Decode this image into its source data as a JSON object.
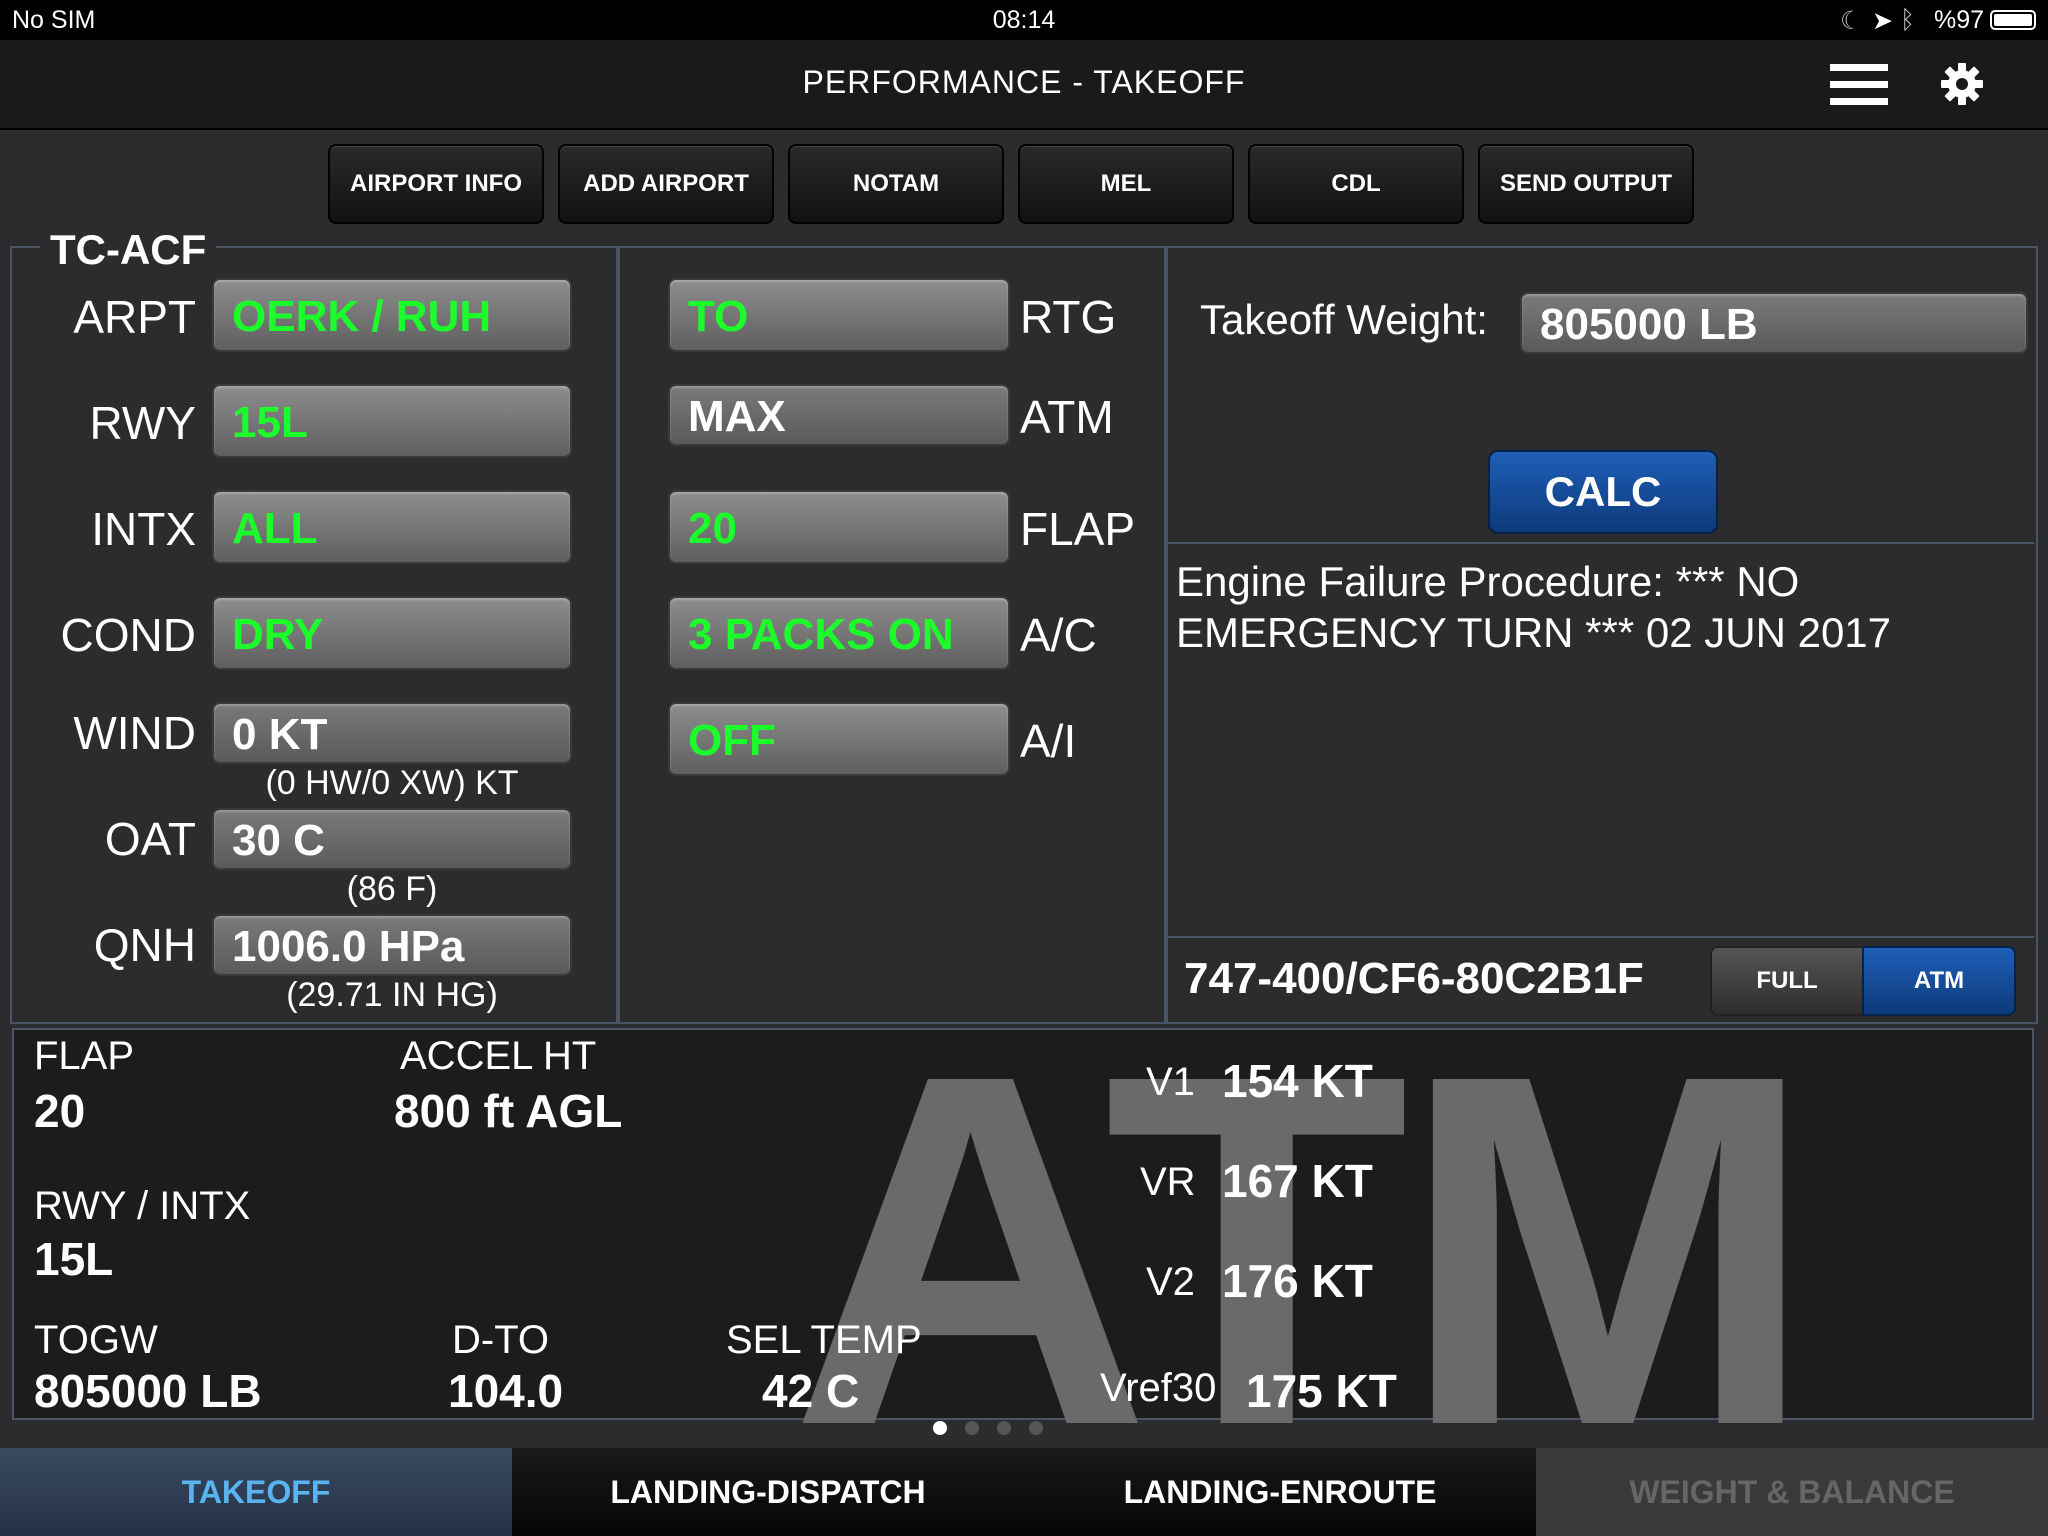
{
  "status": {
    "carrier": "No SIM",
    "time": "08:14",
    "battery": "%97"
  },
  "nav": {
    "title": "PERFORMANCE - TAKEOFF"
  },
  "topbuttons": [
    "AIRPORT INFO",
    "ADD AIRPORT",
    "NOTAM",
    "MEL",
    "CDL",
    "SEND OUTPUT"
  ],
  "tail": "TC-ACF",
  "left": {
    "arpt_label": "ARPT",
    "arpt": "OERK / RUH",
    "rwy_label": "RWY",
    "rwy": "15L",
    "intx_label": "INTX",
    "intx": "ALL",
    "cond_label": "COND",
    "cond": "DRY",
    "wind_label": "WIND",
    "wind": "0 KT",
    "wind_sub": "(0 HW/0 XW) KT",
    "oat_label": "OAT",
    "oat": "30 C",
    "oat_sub": "(86 F)",
    "qnh_label": "QNH",
    "qnh": "1006.0 HPa",
    "qnh_sub": "(29.71 IN HG)"
  },
  "middle": {
    "rtg": "TO",
    "rtg_label": "RTG",
    "atm": "MAX",
    "atm_label": "ATM",
    "flap": "20",
    "flap_label": "FLAP",
    "ac": "3 PACKS ON",
    "ac_label": "A/C",
    "ai": "OFF",
    "ai_label": "A/I"
  },
  "right": {
    "tow_label": "Takeoff Weight:",
    "tow": "805000 LB",
    "calc": "CALC",
    "efp_line1": "Engine Failure Procedure: *** NO",
    "efp_line2": "EMERGENCY TURN *** 02 JUN 2017",
    "aircraft": "747-400/CF6-80C2B1F",
    "seg_full": "FULL",
    "seg_atm": "ATM"
  },
  "results": {
    "flap_label": "FLAP",
    "flap": "20",
    "accel_label": "ACCEL HT",
    "accel": "800 ft AGL",
    "rwy_label": "RWY / INTX",
    "rwy": "15L",
    "togw_label": "TOGW",
    "togw": "805000 LB",
    "dto_label": "D-TO",
    "dto": "104.0",
    "sel_label": "SEL TEMP",
    "sel": "42 C",
    "v1_label": "V1",
    "v1": "154 KT",
    "vr_label": "VR",
    "vr": "167 KT",
    "v2_label": "V2",
    "v2": "176 KT",
    "vref_label": "Vref30",
    "vref": "175 KT",
    "watermark": "ATM"
  },
  "tabs": [
    "TAKEOFF",
    "LANDING-DISPATCH",
    "LANDING-ENROUTE",
    "WEIGHT & BALANCE"
  ],
  "colors": {
    "green": "#1bff2a",
    "accent": "#1a4fa0",
    "active_tab": "#5ab4f0"
  }
}
